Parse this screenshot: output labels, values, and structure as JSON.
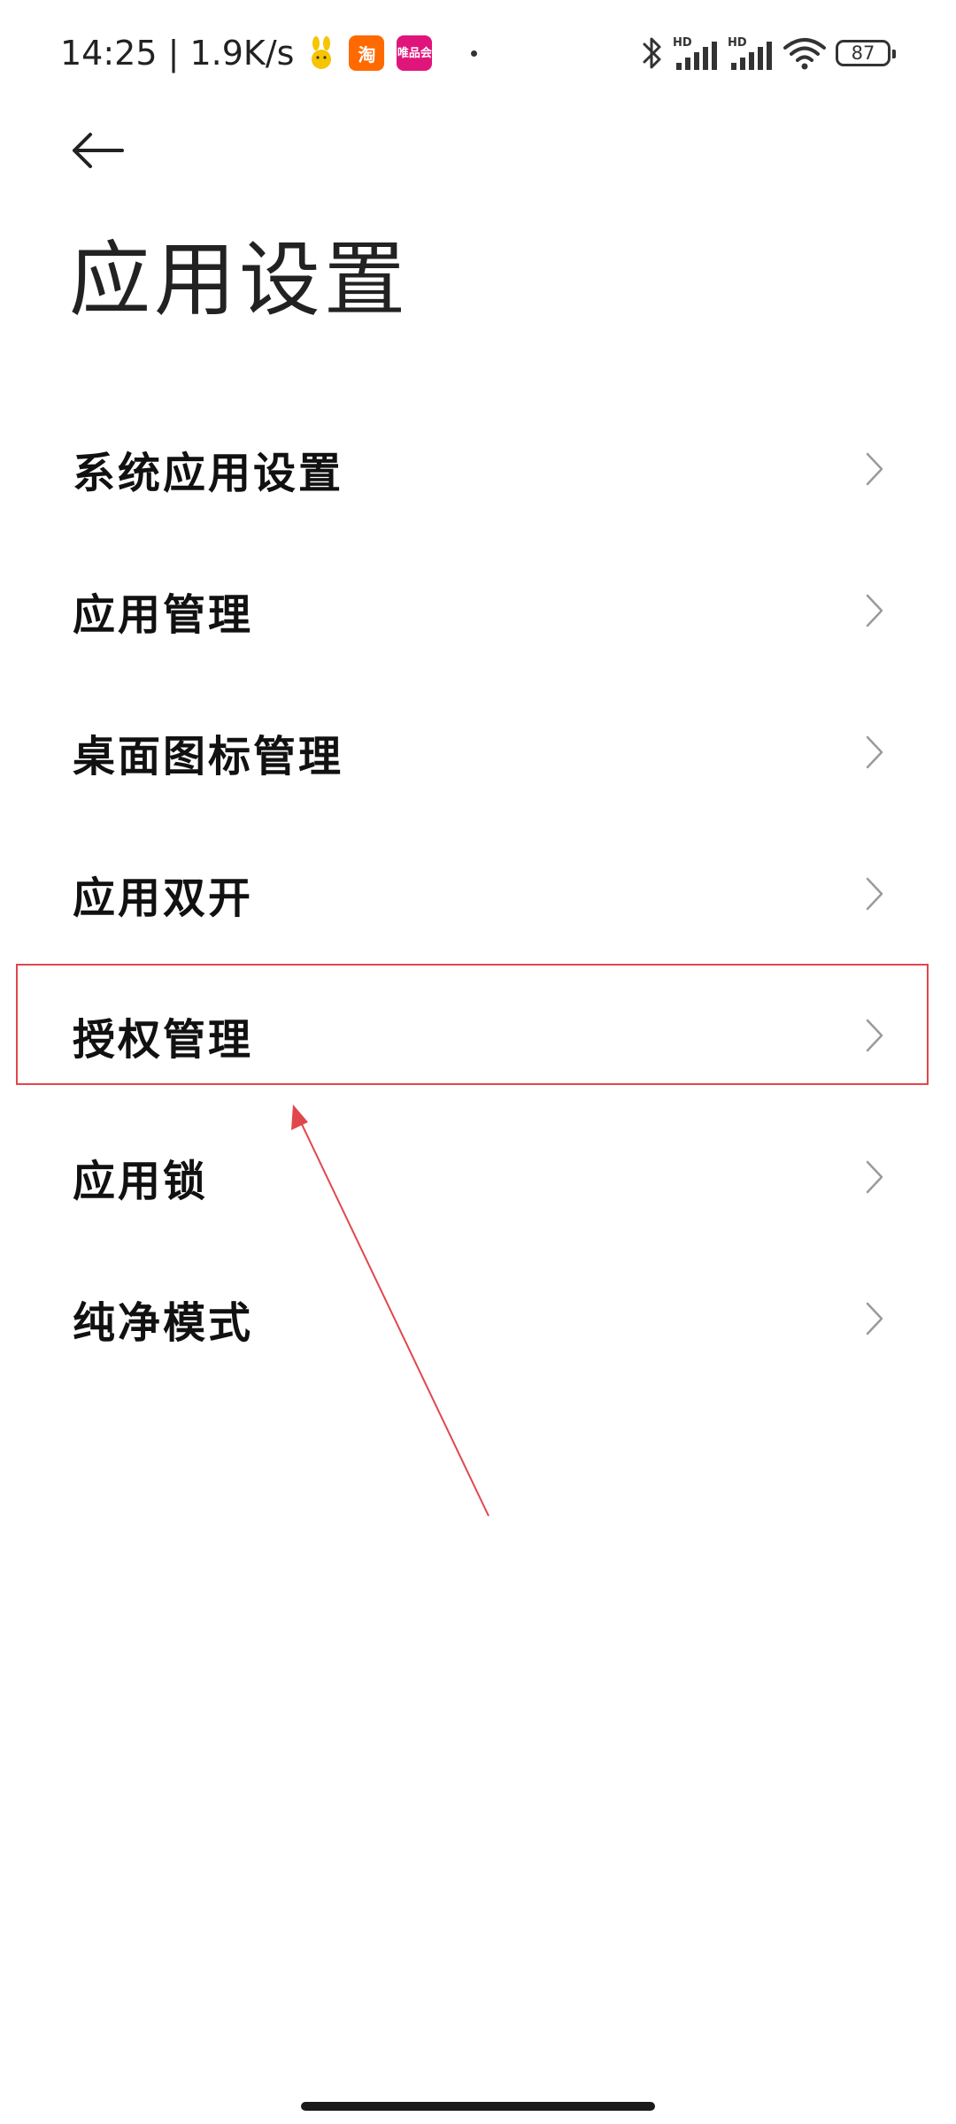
{
  "status_bar": {
    "time_speed": "14:25 | 1.9K/s",
    "notification_icons": [
      "rabbit-app-icon",
      "taobao-icon",
      "vipshop-icon"
    ],
    "taobao_glyph": "淘",
    "vipshop_glyph": "唯品会",
    "right_icons": [
      "bluetooth-icon",
      "hd-signal-icon",
      "hd-signal-icon",
      "wifi-icon"
    ],
    "hd_label": "HD",
    "battery_level": "87"
  },
  "header": {
    "back_icon": "arrow-left-icon",
    "title": "应用设置"
  },
  "menu": {
    "items": [
      {
        "label": "系统应用设置",
        "icon": "chevron-right-icon"
      },
      {
        "label": "应用管理",
        "icon": "chevron-right-icon"
      },
      {
        "label": "桌面图标管理",
        "icon": "chevron-right-icon"
      },
      {
        "label": "应用双开",
        "icon": "chevron-right-icon"
      },
      {
        "label": "授权管理",
        "icon": "chevron-right-icon",
        "highlighted": true
      },
      {
        "label": "应用锁",
        "icon": "chevron-right-icon"
      },
      {
        "label": "纯净模式",
        "icon": "chevron-right-icon"
      }
    ]
  },
  "annotation": {
    "highlight_color": "#e0474c",
    "arrow_color": "#e0474c",
    "target": "授权管理"
  }
}
